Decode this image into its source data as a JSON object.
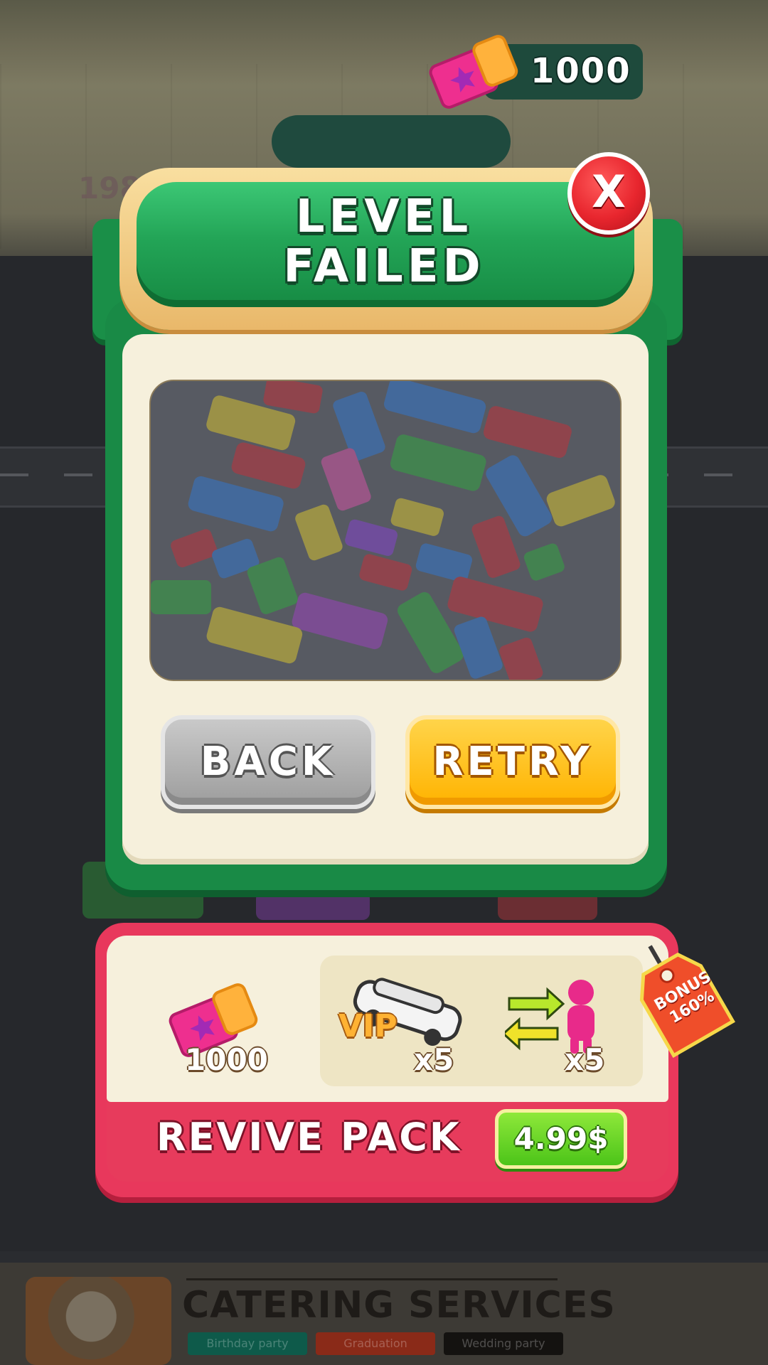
{
  "currency": {
    "amount": "1000",
    "icon": "ticket-icon"
  },
  "dialog": {
    "title_line1": "LEVEL",
    "title_line2": "FAILED",
    "close_label": "X",
    "back_label": "BACK",
    "retry_label": "RETRY"
  },
  "revive_pack": {
    "title": "REVIVE PACK",
    "price": "4.99$",
    "bonus_tag": "BONUS 160%",
    "items": [
      {
        "icon": "ticket-icon",
        "count": "1000"
      },
      {
        "icon": "vip-limo-icon",
        "label": "VIP",
        "count": "x5"
      },
      {
        "icon": "swap-person-icon",
        "count": "x5"
      }
    ]
  },
  "ad_banner": {
    "title": "CATERING SERVICES",
    "tags": [
      "Birthday party",
      "Graduation",
      "Wedding party"
    ]
  },
  "background": {
    "score": "198"
  },
  "colors": {
    "panel_green": "#198a46",
    "retry_yellow": "#ffb300",
    "back_gray": "#9d9d9d",
    "pack_pink": "#e73b5c",
    "price_green": "#4cc419",
    "close_red": "#e8262e"
  }
}
